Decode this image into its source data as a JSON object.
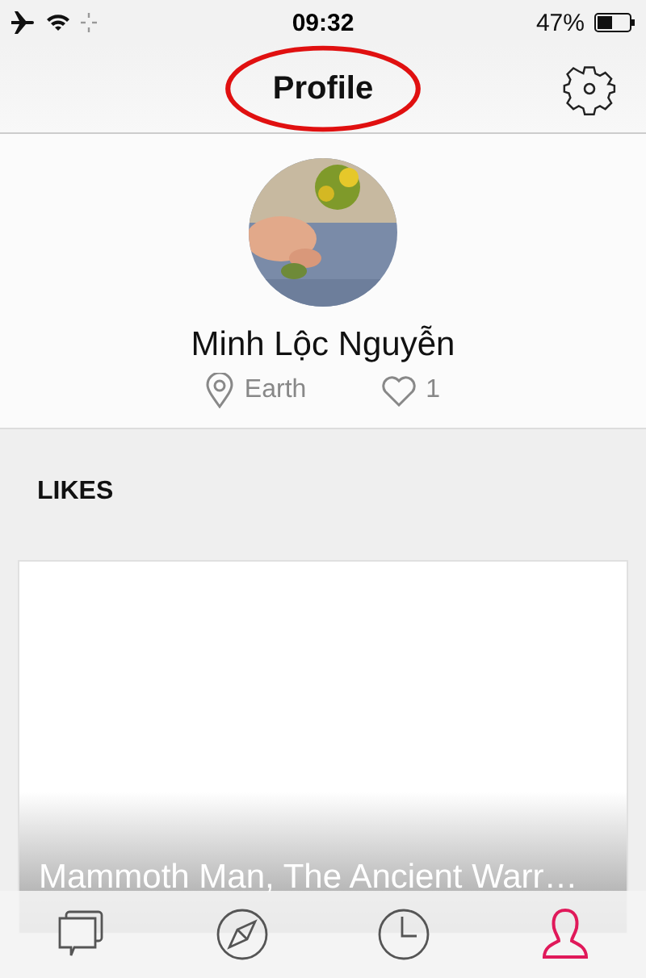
{
  "status_bar": {
    "time": "09:32",
    "battery": "47%"
  },
  "nav": {
    "title": "Profile"
  },
  "profile": {
    "name": "Minh Lộc Nguyễn",
    "location": "Earth",
    "likes": "1"
  },
  "likes": {
    "heading": "LIKES",
    "cards": [
      {
        "title": "Mammoth Man, The Ancient Warr…"
      }
    ]
  },
  "tabs": [
    {
      "kind": "chat",
      "selected": false
    },
    {
      "kind": "compass",
      "selected": false
    },
    {
      "kind": "clock",
      "selected": false
    },
    {
      "kind": "profile",
      "selected": true
    }
  ]
}
